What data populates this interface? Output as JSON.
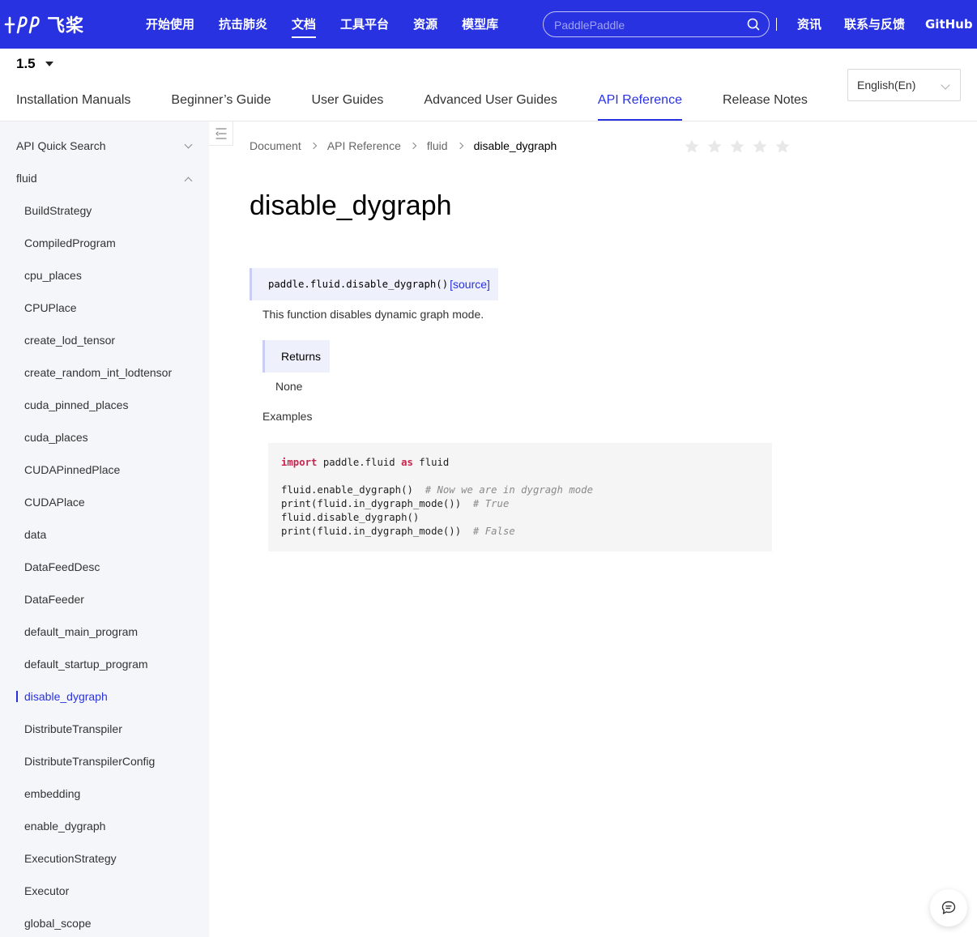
{
  "header": {
    "logo_text": "飞桨",
    "nav": [
      "开始使用",
      "抗击肺炎",
      "文档",
      "工具平台",
      "资源",
      "模型库"
    ],
    "active_nav_index": 2,
    "search_placeholder": "PaddlePaddle",
    "right_links": [
      "资讯",
      "联系与反馈",
      "GitHub"
    ],
    "brand_color": "#2932e1"
  },
  "version": "1.5",
  "tabs": [
    "Installation Manuals",
    "Beginner’s Guide",
    "User Guides",
    "Advanced User Guides",
    "API Reference",
    "Release Notes"
  ],
  "active_tab_index": 4,
  "language": "English(En)",
  "sidebar": {
    "sections": [
      {
        "label": "API Quick Search",
        "expanded": false
      },
      {
        "label": "fluid",
        "expanded": true
      }
    ],
    "items": [
      "BuildStrategy",
      "CompiledProgram",
      "cpu_places",
      "CPUPlace",
      "create_lod_tensor",
      "create_random_int_lodtensor",
      "cuda_pinned_places",
      "cuda_places",
      "CUDAPinnedPlace",
      "CUDAPlace",
      "data",
      "DataFeedDesc",
      "DataFeeder",
      "default_main_program",
      "default_startup_program",
      "disable_dygraph",
      "DistributeTranspiler",
      "DistributeTranspilerConfig",
      "embedding",
      "enable_dygraph",
      "ExecutionStrategy",
      "Executor",
      "global_scope"
    ],
    "active_item": "disable_dygraph"
  },
  "breadcrumb": [
    "Document",
    "API Reference",
    "fluid",
    "disable_dygraph"
  ],
  "rating": {
    "stars": 5,
    "filled": 0
  },
  "content": {
    "title": "disable_dygraph",
    "signature": "paddle.fluid.disable_dygraph()",
    "source_link": "[source]",
    "description": "This function disables dynamic graph mode.",
    "returns_label": "Returns",
    "returns_value": "None",
    "examples_label": "Examples",
    "code": {
      "line1_kw1": "import",
      "line1_mid": " paddle.fluid ",
      "line1_kw2": "as",
      "line1_end": " fluid",
      "line3_code": "fluid.enable_dygraph()  ",
      "line3_comment": "# Now we are in dygragh mode",
      "line4_code": "print(fluid.in_dygraph_mode())  ",
      "line4_comment": "# True",
      "line5_code": "fluid.disable_dygraph()",
      "line6_code": "print(fluid.in_dygraph_mode())  ",
      "line6_comment": "# False"
    }
  }
}
